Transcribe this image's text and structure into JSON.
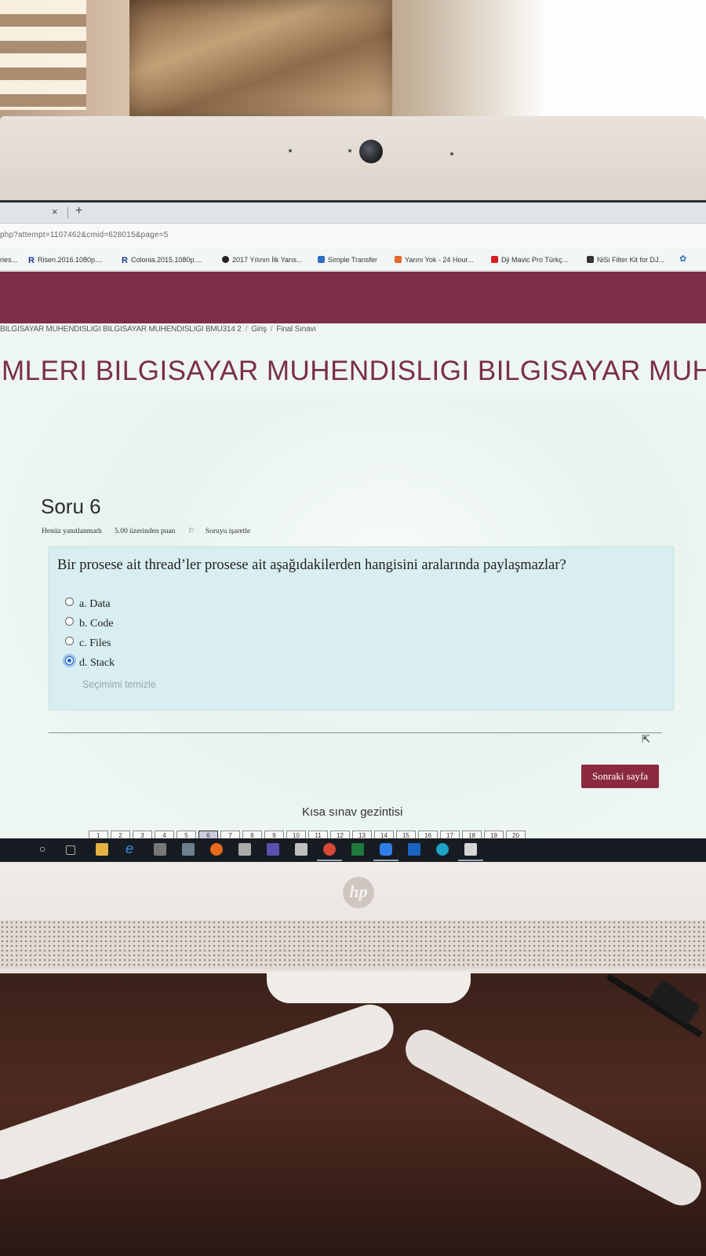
{
  "browser": {
    "tab_close": "×",
    "tab_new": "+",
    "url": "php?attempt=1107462&cmid=628015&page=5",
    "bookmarks": [
      {
        "label": "ries...",
        "icon": "bookmark-icon"
      },
      {
        "label": "Risen.2016.1080p....",
        "icon": "r-logo-icon"
      },
      {
        "label": "Colonia.2015.1080p....",
        "icon": "r-logo-icon"
      },
      {
        "label": "2017 Yılının İlk Yarıs...",
        "icon": "disqus-icon"
      },
      {
        "label": "Simple Transfer",
        "icon": "app-icon"
      },
      {
        "label": "Yarını Yok - 24 Hour...",
        "icon": "orange-app-icon"
      },
      {
        "label": "Dji Mavic Pro Türkç...",
        "icon": "youtube-icon"
      },
      {
        "label": "NiSi Filter Kit for DJ...",
        "icon": "amazon-icon"
      }
    ]
  },
  "page": {
    "breadcrumb": [
      "BILGISAYAR MUHENDISLIGI BILGISAYAR MUHENDISLIGI BMU314 2",
      "Giriş",
      "Final Sınavı"
    ],
    "breadcrumb_sep": "/",
    "course_title": "MLERI BILGISAYAR MUHENDISLIGI BILGISAYAR MUHEN"
  },
  "question": {
    "title": "Soru 6",
    "status": "Henüz yanıtlanmadı",
    "points": "5.00 üzerinden puan",
    "flag_label": "Soruyu işaretle",
    "text": "Bir prosese ait thread’ler prosese ait aşağıdakilerden hangisini aralarında paylaşmazlar?",
    "options": [
      {
        "label": "a. Data",
        "selected": false
      },
      {
        "label": "b. Code",
        "selected": false
      },
      {
        "label": "c. Files",
        "selected": false
      },
      {
        "label": "d. Stack",
        "selected": true
      }
    ],
    "clear_label": "Seçimimi temizle"
  },
  "navigation": {
    "next_button": "Sonraki sayfa",
    "quiz_nav_title": "Kısa sınav gezintisi",
    "pages": [
      "1",
      "2",
      "3",
      "4",
      "5",
      "6",
      "7",
      "8",
      "9",
      "10",
      "11",
      "12",
      "13",
      "14",
      "15",
      "16",
      "17",
      "18",
      "19",
      "20"
    ],
    "current_page": "6"
  },
  "device": {
    "brand": "hp"
  },
  "colors": {
    "header": "#7d2f4a",
    "title": "#7a2f45",
    "button": "#8b2a3f",
    "question_box": "#d9eef0"
  }
}
